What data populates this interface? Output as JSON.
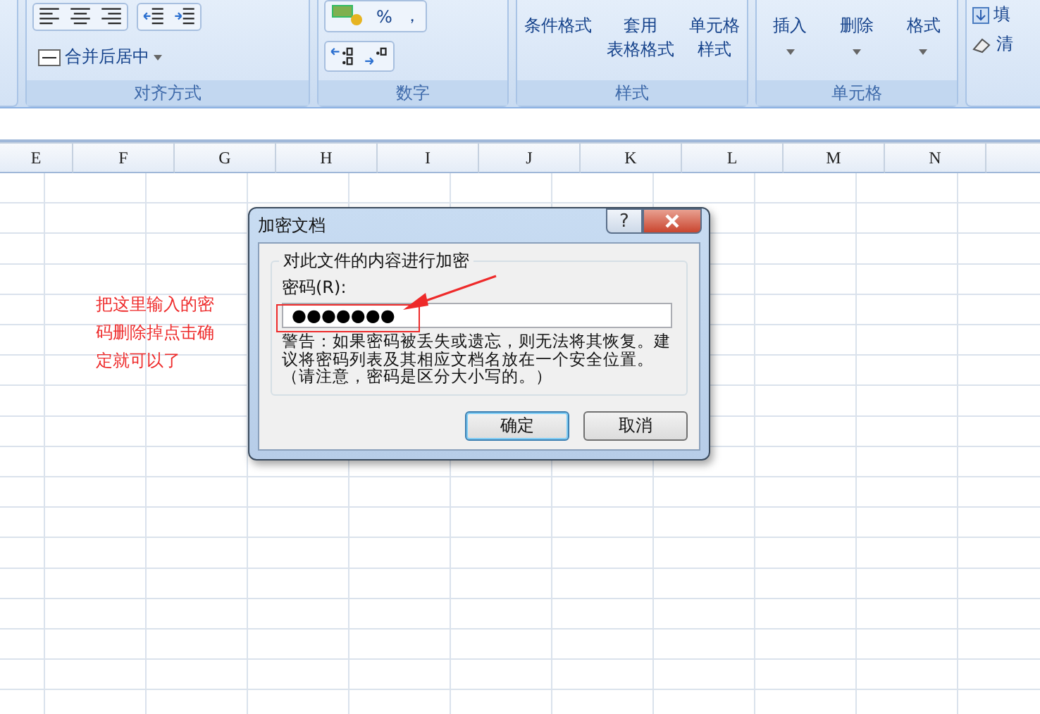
{
  "ribbon": {
    "alignment": {
      "label": "对齐方式",
      "merge_button": "合并后居中"
    },
    "number": {
      "label": "数字",
      "percent": "%",
      "comma": "，"
    },
    "styles": {
      "label": "样式",
      "buttons": [
        {
          "lines": [
            "条件格式"
          ]
        },
        {
          "lines": [
            "套用",
            "表格格式"
          ]
        },
        {
          "lines": [
            "单元格",
            "样式"
          ]
        }
      ]
    },
    "cells": {
      "label": "单元格",
      "buttons": [
        "插入",
        "删除",
        "格式"
      ]
    },
    "editing": {
      "items": [
        "填",
        "清"
      ]
    }
  },
  "sheet": {
    "columns": [
      "E",
      "F",
      "G",
      "H",
      "I",
      "J",
      "K",
      "L",
      "M",
      "N",
      ""
    ]
  },
  "annotation": {
    "text": "把这里输入的密码删除掉点击确定就可以了"
  },
  "dialog": {
    "title": "加密文档",
    "help": "?",
    "group_title": "对此文件的内容进行加密",
    "password_label": "密码(R):",
    "password_value": "●●●●●●●",
    "warning": "警告：如果密码被丢失或遗忘，则无法将其恢复。建议将密码列表及其相应文档名放在一个安全位置。（请注意，密码是区分大小写的。）",
    "buttons": [
      {
        "label": "确定",
        "default": true
      },
      {
        "label": "取消",
        "default": false
      }
    ]
  }
}
